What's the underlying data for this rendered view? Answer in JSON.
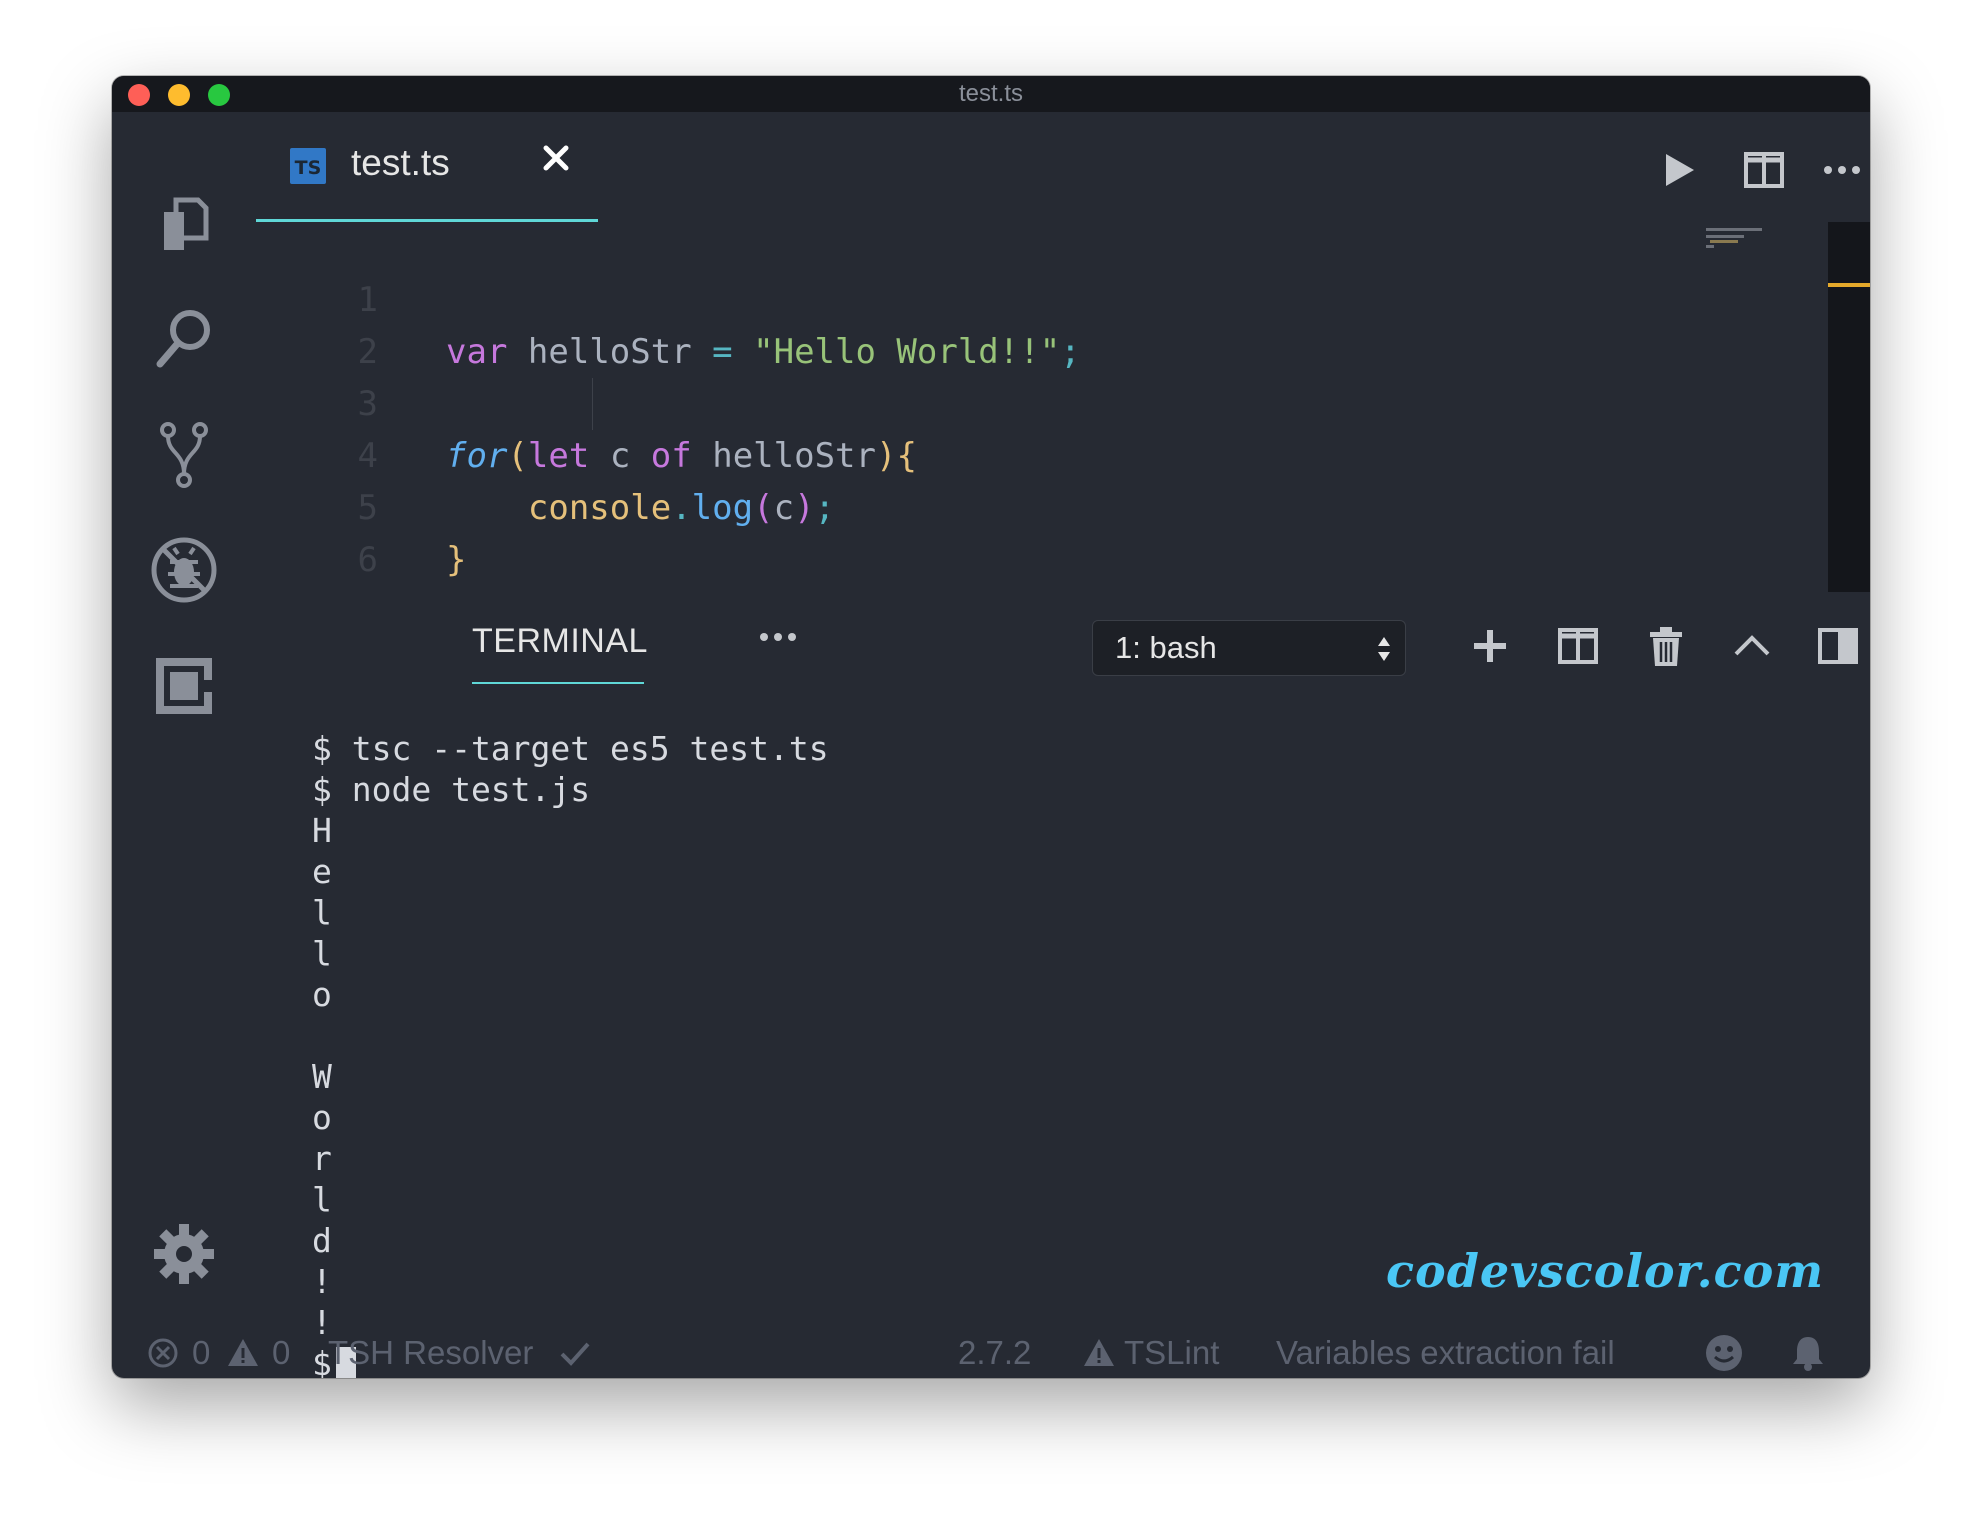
{
  "window": {
    "title": "test.ts"
  },
  "activity_bar": {
    "items": [
      {
        "icon": "files-icon"
      },
      {
        "icon": "search-icon"
      },
      {
        "icon": "source-control-icon"
      },
      {
        "icon": "debug-icon"
      },
      {
        "icon": "extensions-icon"
      },
      {
        "icon": "gear-icon"
      }
    ]
  },
  "tabs": [
    {
      "badge": "TS",
      "label": "test.ts",
      "active": true
    }
  ],
  "editor": {
    "lines": [
      {
        "number": "1"
      },
      {
        "number": "2"
      },
      {
        "number": "3"
      },
      {
        "number": "4"
      },
      {
        "number": "5"
      },
      {
        "number": "6"
      }
    ],
    "tokens": {
      "var": "var",
      "helloStr": "helloStr",
      "eq": "=",
      "str": "\"Hello World!!\"",
      "semi": ";",
      "for": "for",
      "lparen": "(",
      "let": "let",
      "c": "c",
      "of": "of",
      "rparen_brace": "){",
      "console": "console",
      "dot": ".",
      "log": "log",
      "call_open": "(",
      "call_close": ")",
      "close_brace": "}"
    }
  },
  "panel": {
    "tab_label": "TERMINAL",
    "terminal_select": "1: bash",
    "terminal_lines": [
      "$ tsc --target es5 test.ts",
      "$ node test.js",
      "H",
      "e",
      "l",
      "l",
      "o",
      "",
      "W",
      "o",
      "r",
      "l",
      "d",
      "!",
      "!"
    ],
    "prompt": "$"
  },
  "watermark": "codevscolor.com",
  "status_bar": {
    "errors": "0",
    "warnings": "0",
    "tsh_resolver": "TSH Resolver",
    "ts_version": "2.7.2",
    "tslint": "TSLint",
    "message": "Variables extraction fail"
  },
  "colors": {
    "background": "#262a33",
    "titlebar": "#16181d",
    "accent": "#5fd7d7",
    "watermark": "#4ac7f5",
    "scroll_marker": "#e5a92b"
  }
}
